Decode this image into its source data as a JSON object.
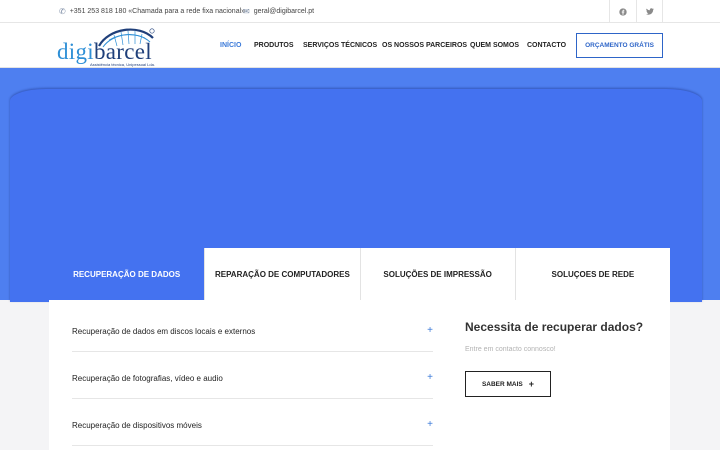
{
  "topbar": {
    "phone_icon": "phone-icon",
    "phone": "+351 253 818 180 «Chamada para a rede fixa nacional»",
    "email_icon": "envelope-icon",
    "email": "geral@digibarcel.pt",
    "social": [
      "facebook-icon",
      "twitter-icon"
    ]
  },
  "logo": {
    "word_a": "digi",
    "word_b": "barcel",
    "tagline": "Assistência técnica, Unipessoal Lda."
  },
  "nav": {
    "items": [
      "INÍCIO",
      "PRODUTOS",
      "SERVIÇOS TÉCNICOS",
      "OS NOSSOS PARCEIROS",
      "QUEM SOMOS",
      "CONTACTO"
    ],
    "active_index": 0,
    "cta": "ORÇAMENTO GRÁTIS"
  },
  "tabs": {
    "items": [
      "RECUPERAÇÃO DE DADOS",
      "REPARAÇÃO DE COMPUTADORES",
      "SOLUÇÕES DE IMPRESSÃO",
      "SOLUÇOES DE REDE"
    ],
    "active_index": 0
  },
  "accordion": {
    "items": [
      "Recuperação de dados em discos locais e externos",
      "Recuperação de fotografias, vídeo e audio",
      "Recuperação de dispositivos móveis"
    ],
    "expand_symbol": "+"
  },
  "sidebar": {
    "title": "Necessita de recuperar dados?",
    "subtitle": "Entre em contacto connosco!",
    "button": "SABER MAIS",
    "button_plus": "+"
  },
  "colors": {
    "accent": "#3b7ad9",
    "hero": "#4472f0",
    "hero_bg": "#4e7ff0",
    "brand_dark": "#1f3f7a",
    "brand_light": "#2e8fd6"
  }
}
